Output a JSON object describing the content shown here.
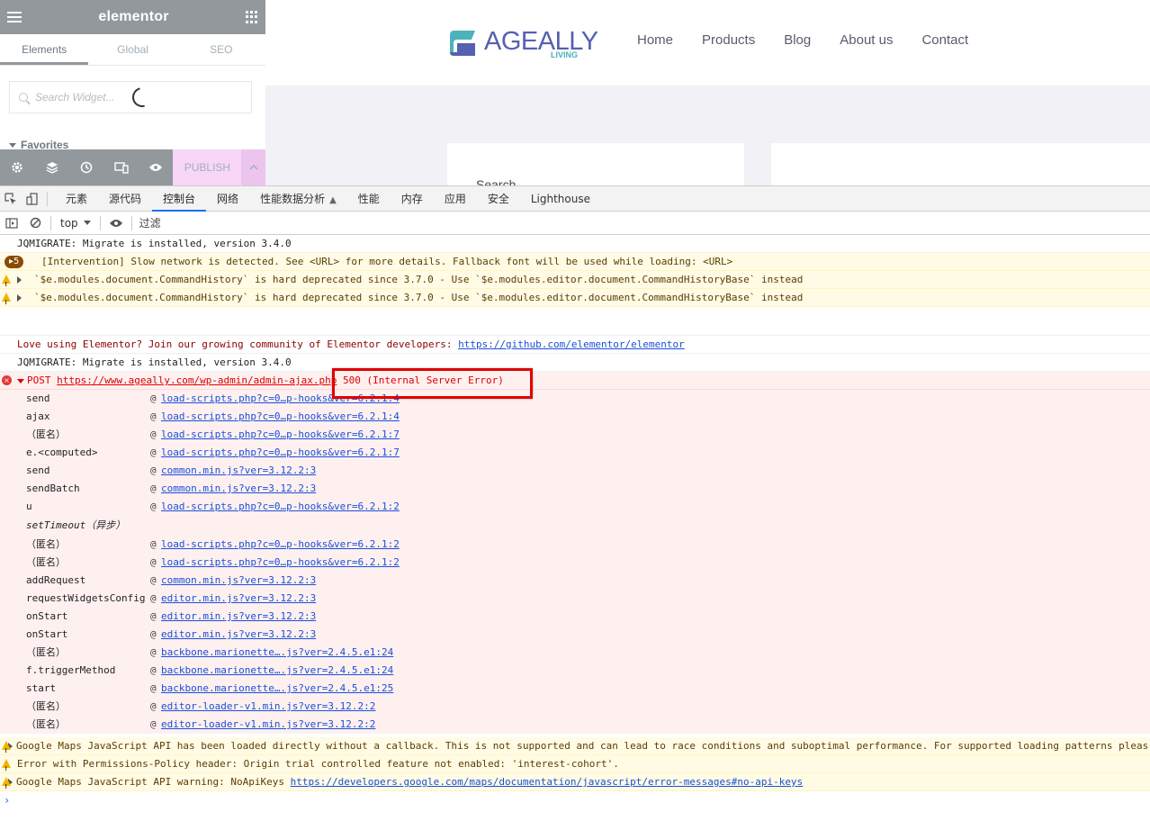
{
  "elementor": {
    "brand": "elementor",
    "tabs": [
      "Elements",
      "Global",
      "SEO"
    ],
    "search_placeholder": "Search Widget...",
    "favorites_label": "Favorites",
    "publish_label": "PUBLISH"
  },
  "site": {
    "logo_name": "AGEALLY",
    "logo_tag": "LIVING",
    "nav": [
      "Home",
      "Products",
      "Blog",
      "About us",
      "Contact"
    ],
    "search_label": "Search",
    "colors": {
      "logo_blue": "#5560b0",
      "logo_teal": "#4cb2bb"
    }
  },
  "devtools": {
    "tabs": [
      "元素",
      "源代码",
      "控制台",
      "网络",
      "性能数据分析",
      "性能",
      "内存",
      "应用",
      "安全",
      "Lighthouse"
    ],
    "active_tab": "控制台",
    "context": "top",
    "filter_placeholder": "过滤",
    "console": {
      "l1": "JQMIGRATE: Migrate is installed, version 3.4.0",
      "badge_count": "5",
      "l2": "[Intervention] Slow network is detected. See <URL> for more details. Fallback font will be used while loading: <URL>",
      "l3": "`$e.modules.document.CommandHistory` is hard deprecated since 3.7.0 - Use `$e.modules.editor.document.CommandHistoryBase` instead",
      "l4": "`$e.modules.document.CommandHistory` is hard deprecated since 3.7.0 - Use `$e.modules.editor.document.CommandHistoryBase` instead",
      "l5_text": "Love using Elementor? Join our growing community of Elementor developers: ",
      "l5_link": "https://github.com/elementor/elementor",
      "l6": "JQMIGRATE: Migrate is installed, version 3.4.0",
      "err_method": "POST",
      "err_url": "https://www.ageally.com/wp-admin/admin-ajax.php",
      "err_status": "500 (Internal Server Error)",
      "stack": [
        {
          "fn": "send",
          "src": "load-scripts.php?c=0…p-hooks&ver=6.2.1:4"
        },
        {
          "fn": "ajax",
          "src": "load-scripts.php?c=0…p-hooks&ver=6.2.1:4"
        },
        {
          "fn": "（匿名）",
          "src": "load-scripts.php?c=0…p-hooks&ver=6.2.1:7"
        },
        {
          "fn": "e.<computed>",
          "src": "load-scripts.php?c=0…p-hooks&ver=6.2.1:7"
        },
        {
          "fn": "send",
          "src": "common.min.js?ver=3.12.2:3"
        },
        {
          "fn": "sendBatch",
          "src": "common.min.js?ver=3.12.2:3"
        },
        {
          "fn": "u",
          "src": "load-scripts.php?c=0…p-hooks&ver=6.2.1:2"
        }
      ],
      "async_label": "setTimeout（异步）",
      "stack2": [
        {
          "fn": "（匿名）",
          "src": "load-scripts.php?c=0…p-hooks&ver=6.2.1:2"
        },
        {
          "fn": "（匿名）",
          "src": "load-scripts.php?c=0…p-hooks&ver=6.2.1:2"
        },
        {
          "fn": "addRequest",
          "src": "common.min.js?ver=3.12.2:3"
        },
        {
          "fn": "requestWidgetsConfig",
          "src": "editor.min.js?ver=3.12.2:3"
        },
        {
          "fn": "onStart",
          "src": "editor.min.js?ver=3.12.2:3"
        },
        {
          "fn": "onStart",
          "src": "editor.min.js?ver=3.12.2:3"
        },
        {
          "fn": "（匿名）",
          "src": "backbone.marionette….js?ver=2.4.5.e1:24"
        },
        {
          "fn": "f.triggerMethod",
          "src": "backbone.marionette….js?ver=2.4.5.e1:24"
        },
        {
          "fn": "start",
          "src": "backbone.marionette….js?ver=2.4.5.e1:25"
        },
        {
          "fn": "（匿名）",
          "src": "editor-loader-v1.min.js?ver=3.12.2:2"
        },
        {
          "fn": "（匿名）",
          "src": "editor-loader-v1.min.js?ver=3.12.2:2"
        }
      ],
      "w1": "Google Maps JavaScript API has been loaded directly without a callback. This is not supported and can lead to race conditions and suboptimal performance. For supported loading patterns pleas",
      "w2": "Error with Permissions-Policy header: Origin trial controlled feature not enabled: 'interest-cohort'.",
      "w3_text": "Google Maps JavaScript API warning: NoApiKeys ",
      "w3_link": "https://developers.google.com/maps/documentation/javascript/error-messages#no-api-keys"
    }
  }
}
